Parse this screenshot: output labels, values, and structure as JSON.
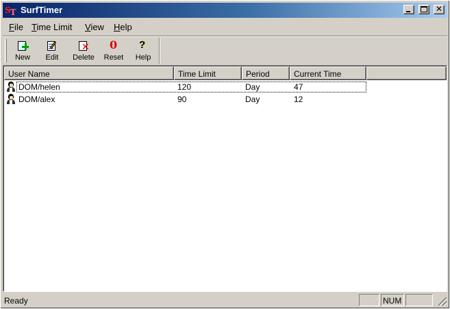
{
  "window": {
    "title": "SurfTimer",
    "app_icon_letters": [
      "S",
      "T"
    ]
  },
  "menu": {
    "items": [
      {
        "label": "File",
        "accel": "F"
      },
      {
        "label": "Time Limit",
        "accel": "T"
      },
      {
        "label": "View",
        "accel": "V"
      },
      {
        "label": "Help",
        "accel": "H"
      }
    ]
  },
  "toolbar": {
    "buttons": [
      {
        "label": "New",
        "icon": "new-icon"
      },
      {
        "label": "Edit",
        "icon": "edit-icon"
      },
      {
        "label": "Delete",
        "icon": "delete-icon"
      },
      {
        "label": "Reset",
        "icon": "reset-icon"
      },
      {
        "label": "Help",
        "icon": "help-icon"
      }
    ],
    "reset_glyph": "0",
    "help_glyph": "?"
  },
  "list": {
    "columns": [
      "User Name",
      "Time Limit",
      "Period",
      "Current Time"
    ],
    "rows": [
      {
        "user": "DOM/helen",
        "time_limit": "120",
        "period": "Day",
        "current_time": "47"
      },
      {
        "user": "DOM/alex",
        "time_limit": "90",
        "period": "Day",
        "current_time": "12"
      }
    ]
  },
  "status": {
    "text": "Ready",
    "panels": [
      "",
      "NUM",
      ""
    ]
  },
  "colors": {
    "title_gradient_start": "#0a246a",
    "title_gradient_end": "#a6caf0",
    "face": "#d4d0c8",
    "app_icon_red": "#ff2020"
  }
}
